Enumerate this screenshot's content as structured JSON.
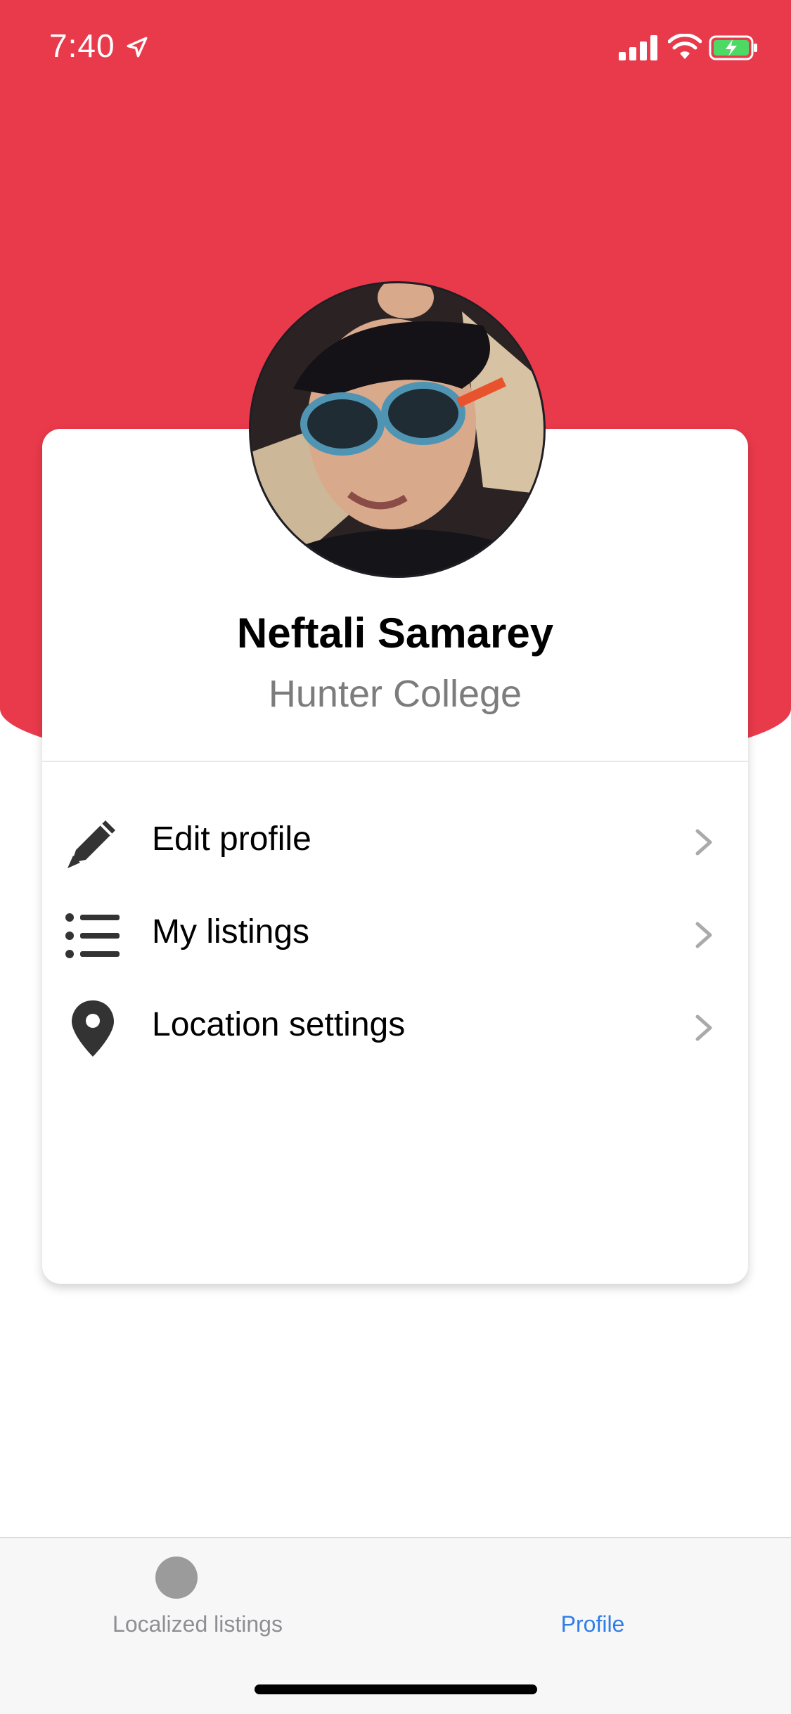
{
  "status_bar": {
    "time": "7:40",
    "icons": [
      "location-arrow-icon",
      "signal-icon",
      "wifi-icon",
      "battery-charging-icon"
    ]
  },
  "colors": {
    "header": "#e93a4b",
    "active_tab": "#2f7ee8",
    "inactive_tab": "#8e8e93",
    "battery": "#4cd964"
  },
  "profile": {
    "name": "Neftali Samarey",
    "school": "Hunter College",
    "avatar": "profile-photo"
  },
  "menu": [
    {
      "label": "Edit profile",
      "icon": "pencil-icon"
    },
    {
      "label": "My listings",
      "icon": "list-icon"
    },
    {
      "label": "Location settings",
      "icon": "map-pin-icon"
    }
  ],
  "tabs": [
    {
      "label": "Localized listings",
      "active": false
    },
    {
      "label": "Profile",
      "active": true
    }
  ]
}
